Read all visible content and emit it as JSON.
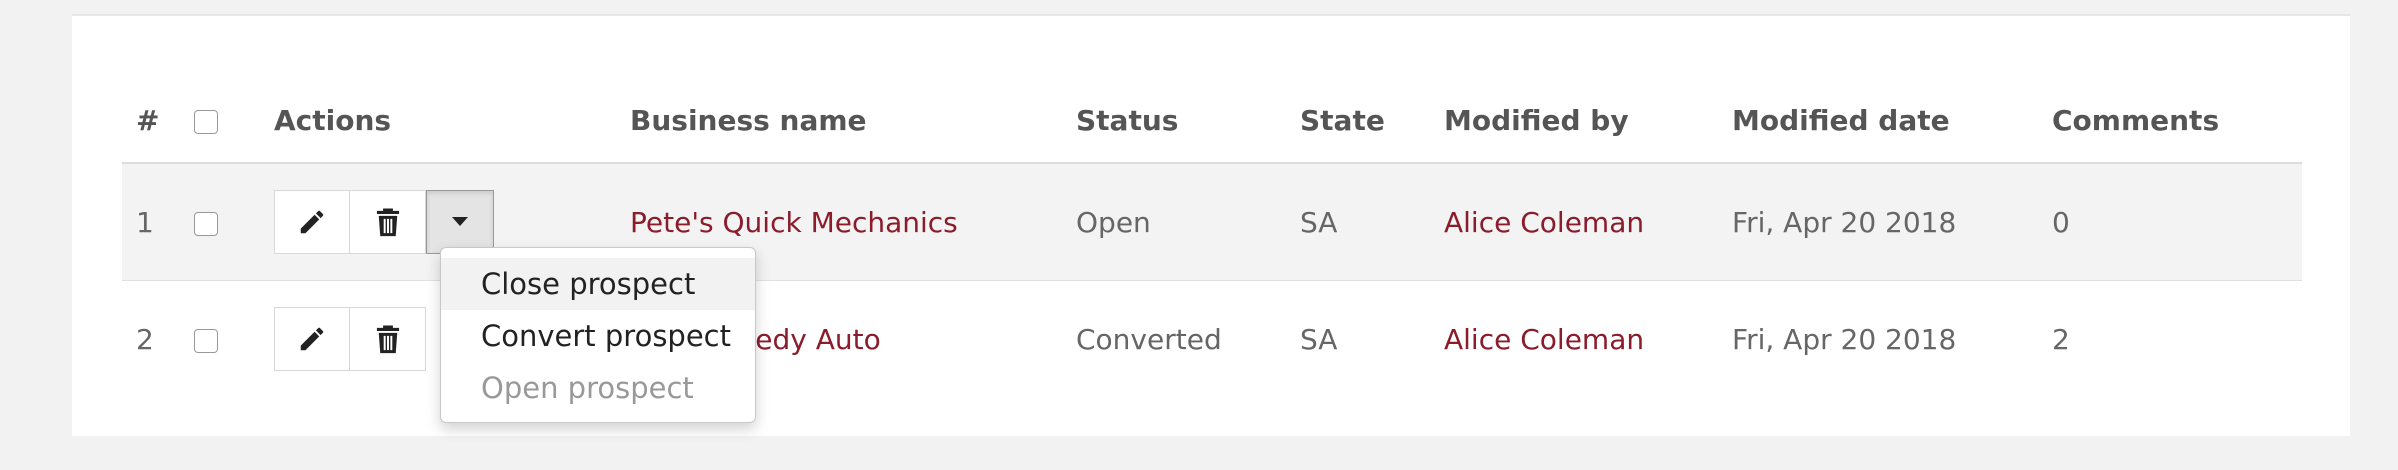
{
  "table": {
    "headers": [
      "#",
      "",
      "Actions",
      "Business name",
      "Status",
      "State",
      "Modified by",
      "Modified date",
      "Comments"
    ],
    "rows": [
      {
        "num": "1",
        "business": "Pete's Quick Mechanics",
        "status": "Open",
        "state": "SA",
        "modified_by": "Alice Coleman",
        "modified_date": "Fri, Apr 20 2018",
        "comments": "0"
      },
      {
        "num": "2",
        "business": "eedy Auto",
        "status": "Converted",
        "state": "SA",
        "modified_by": "Alice Coleman",
        "modified_date": "Fri, Apr 20 2018",
        "comments": "2"
      }
    ]
  },
  "dropdown": {
    "items": [
      "Close prospect",
      "Convert prospect",
      "Open prospect"
    ]
  },
  "colors": {
    "link": "#8a1c2b",
    "row_highlight": "#f3f3f3"
  },
  "icons": {
    "edit": "pencil-icon",
    "delete": "trash-icon",
    "menu": "caret-down-icon"
  }
}
